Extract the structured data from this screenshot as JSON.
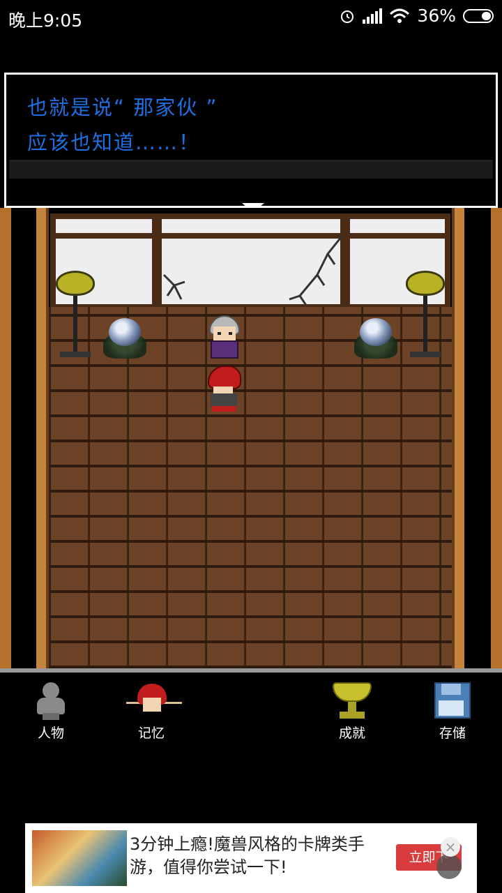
{
  "status_bar": {
    "time": "晚上9:05",
    "battery": "36%",
    "battery_level": 0.36,
    "icons": [
      "alarm-icon",
      "signal-icon",
      "wifi-icon",
      "battery-icon"
    ]
  },
  "dialog": {
    "line1": "也就是说“ 那家伙 ”",
    "line2": "应该也知道……！",
    "text_color": "#1f6fe0"
  },
  "menu": {
    "items": [
      {
        "label": "人物",
        "icon": "person-icon"
      },
      {
        "label": "记忆",
        "icon": "memory-icon"
      },
      {
        "label": "成就",
        "icon": "trophy-icon"
      },
      {
        "label": "存储",
        "icon": "save-disk-icon"
      }
    ]
  },
  "ad": {
    "text": "3分钟上瘾!魔兽风格的卡牌类手游，值得你尝试一下!",
    "cta": "立即下",
    "close": "×"
  }
}
